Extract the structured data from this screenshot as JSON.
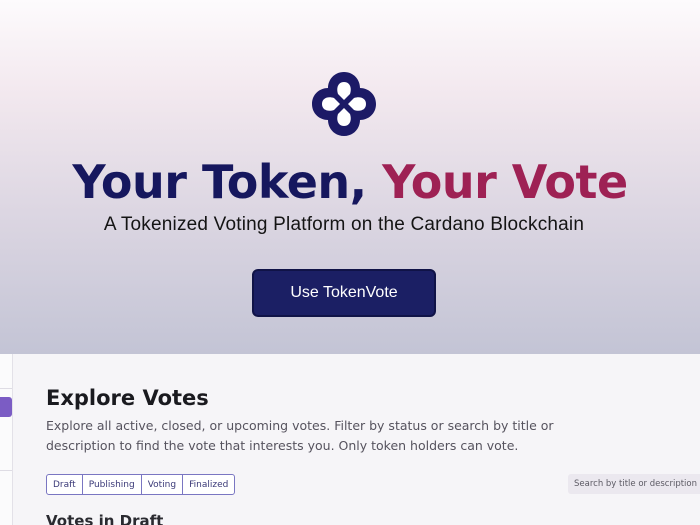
{
  "hero": {
    "logo_icon": "tokenvote-logo-icon",
    "title_part1": "Your Token,",
    "title_part2": "Your Vote",
    "subtitle": "A Tokenized Voting Platform on the Cardano Blockchain",
    "cta_label": "Use TokenVote",
    "colors": {
      "title_primary": "#16175e",
      "title_accent": "#9e2154",
      "button": "#1b1f64"
    }
  },
  "explore": {
    "title": "Explore Votes",
    "description": "Explore all active, closed, or upcoming votes. Filter by status or search by title or description to find the vote that interests you. Only token holders can vote.",
    "filters": [
      "Draft",
      "Publishing",
      "Voting",
      "Finalized"
    ],
    "search_placeholder": "Search by title or description",
    "section_title": "Votes in Draft"
  },
  "sidebar": {
    "active_color": "#7b5cc4"
  }
}
